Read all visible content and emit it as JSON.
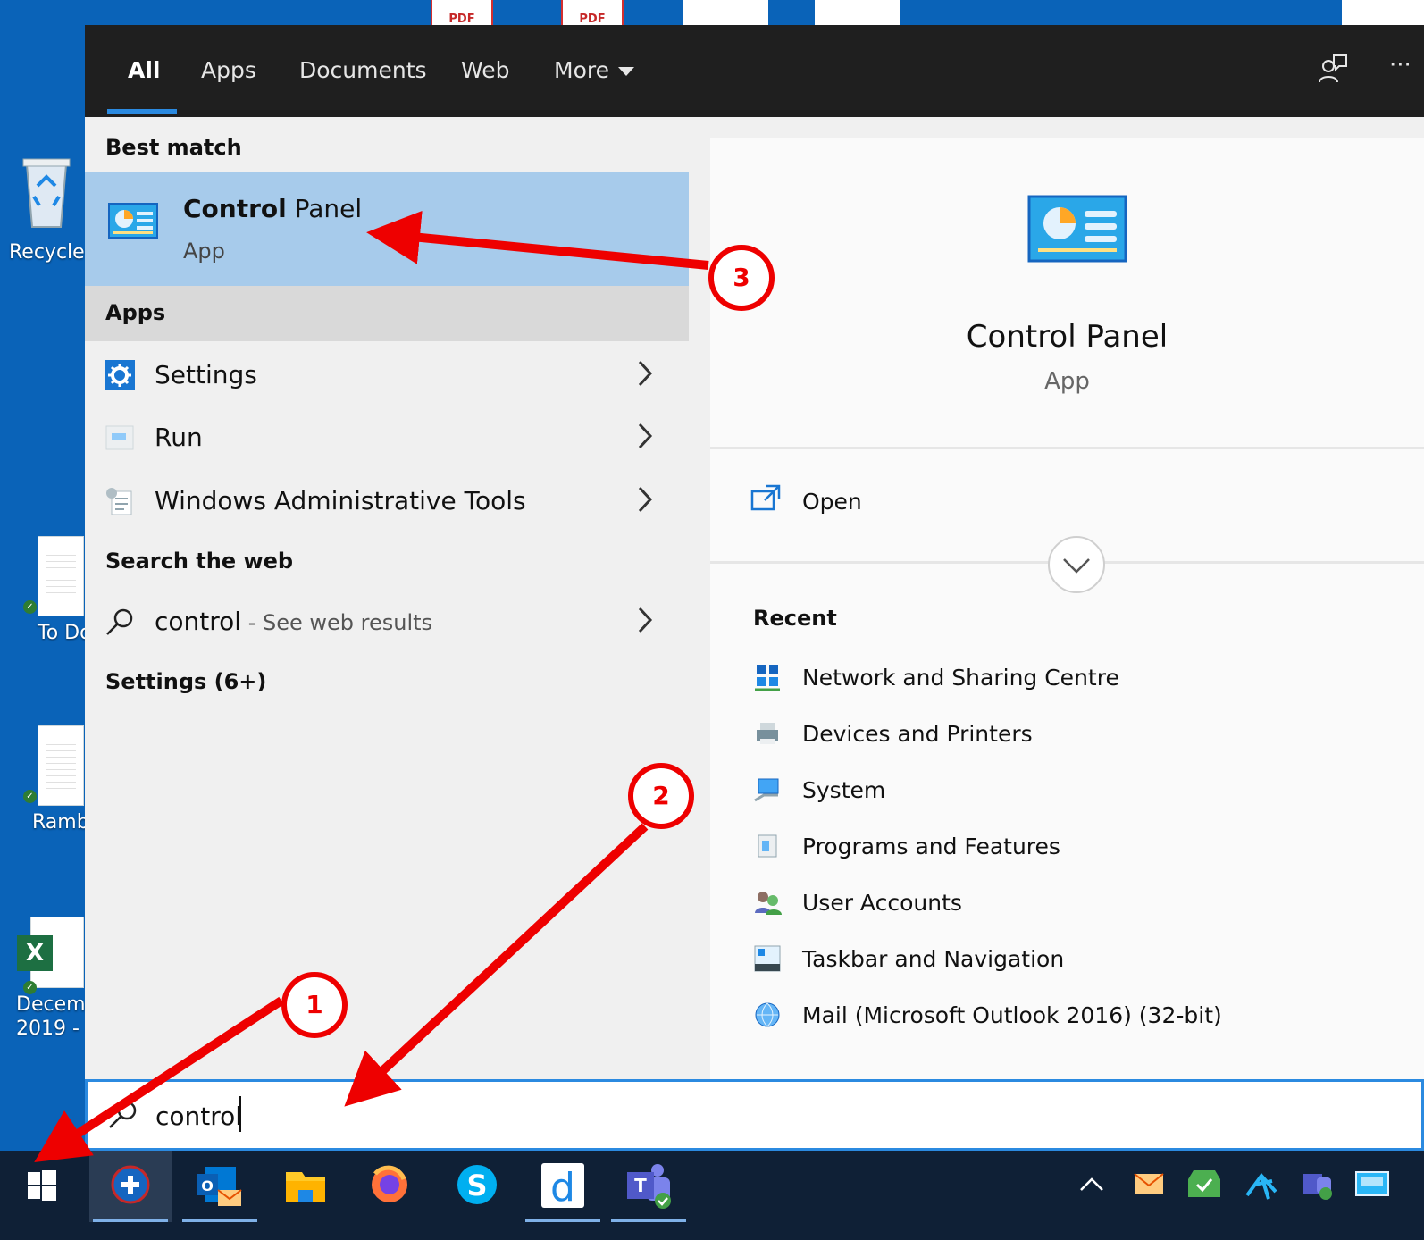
{
  "tabs": [
    {
      "label": "All"
    },
    {
      "label": "Apps"
    },
    {
      "label": "Documents"
    },
    {
      "label": "Web"
    },
    {
      "label": "More"
    }
  ],
  "desktop": {
    "recycle_label": "Recycle",
    "todo_label": "To Do",
    "ramb_label": "Ramb",
    "excel_label1": "Decem",
    "excel_label2": "2019 -",
    "pdf_label": "PDF"
  },
  "best_match": {
    "heading": "Best match",
    "title_bold": "Control",
    "title_rest": " Panel",
    "subtitle": "App"
  },
  "apps": {
    "heading": "Apps",
    "items": [
      {
        "label": "Settings",
        "icon": "settings-gear-icon"
      },
      {
        "label": "Run",
        "icon": "run-icon"
      },
      {
        "label": "Windows Administrative Tools",
        "icon": "admin-tools-icon"
      }
    ]
  },
  "web": {
    "heading": "Search the web",
    "query": "control",
    "suffix": " - See web results"
  },
  "settings_group": {
    "heading": "Settings (6+)"
  },
  "preview": {
    "title": "Control Panel",
    "subtitle": "App",
    "open_label": "Open",
    "recent_heading": "Recent",
    "recent": [
      {
        "label": "Network and Sharing Centre",
        "icon": "network-icon"
      },
      {
        "label": "Devices and Printers",
        "icon": "printer-icon"
      },
      {
        "label": "System",
        "icon": "system-icon"
      },
      {
        "label": "Programs and Features",
        "icon": "programs-icon"
      },
      {
        "label": "User Accounts",
        "icon": "users-icon"
      },
      {
        "label": "Taskbar and Navigation",
        "icon": "taskbar-icon"
      },
      {
        "label": "Mail (Microsoft Outlook 2016) (32-bit)",
        "icon": "mail-globe-icon"
      }
    ]
  },
  "search": {
    "value": "control"
  },
  "annotations": [
    {
      "label": "1"
    },
    {
      "label": "2"
    },
    {
      "label": "3"
    }
  ],
  "colors": {
    "accent": "#2b8ae0",
    "selection": "#a7cbeb",
    "desktop": "#0a63b8",
    "taskbar": "#0f2036",
    "annotation": "#e00000"
  }
}
